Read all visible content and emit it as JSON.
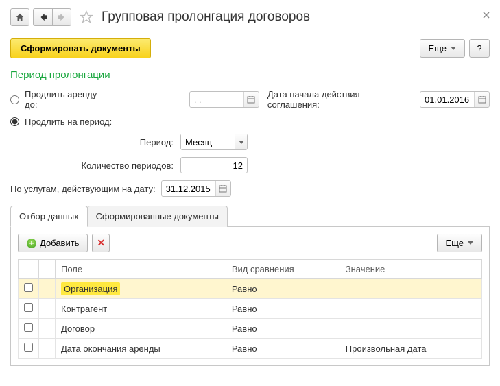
{
  "header": {
    "title": "Групповая пролонгация договоров"
  },
  "toolbar": {
    "primary_label": "Сформировать документы",
    "more_label": "Еще",
    "help_label": "?"
  },
  "section": {
    "title": "Период пролонгации"
  },
  "radios": {
    "until_label": "Продлить аренду до:",
    "period_label": "Продлить на период:"
  },
  "fields": {
    "until_date": ". .",
    "agreement_start_label": "Дата начала действия соглашения:",
    "agreement_start_value": "01.01.2016",
    "period_label": "Период:",
    "period_value": "Месяц",
    "count_label": "Количество периодов:",
    "count_value": "12",
    "services_date_label": "По услугам, действующим на дату:",
    "services_date_value": "31.12.2015"
  },
  "tabs": {
    "filter": "Отбор данных",
    "docs": "Сформированные документы"
  },
  "inner_toolbar": {
    "add_label": "Добавить",
    "more_label": "Еще"
  },
  "table": {
    "headers": {
      "field": "Поле",
      "compare": "Вид сравнения",
      "value": "Значение"
    },
    "rows": [
      {
        "field": "Организация",
        "compare": "Равно",
        "value": "",
        "selected": true
      },
      {
        "field": "Контрагент",
        "compare": "Равно",
        "value": "",
        "selected": false
      },
      {
        "field": "Договор",
        "compare": "Равно",
        "value": "",
        "selected": false
      },
      {
        "field": "Дата окончания аренды",
        "compare": "Равно",
        "value": "Произвольная дата",
        "selected": false
      }
    ]
  }
}
